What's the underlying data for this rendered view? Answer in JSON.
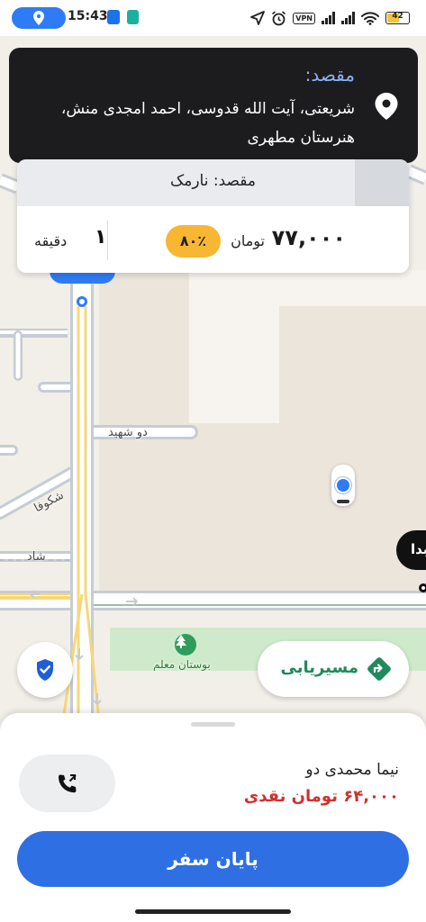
{
  "status_bar": {
    "time": "15:43",
    "vpn_label": "VPN",
    "battery": "42",
    "icons": [
      "location-pill-icon",
      "app-notification-icon",
      "android-icon",
      "navigation-icon",
      "alarm-icon",
      "signal-icon",
      "signal-icon",
      "wifi-icon",
      "battery-icon"
    ]
  },
  "destination_header": {
    "title": "مقصد:",
    "address": "شریعتی، آیت الله قدوسی، احمد امجدی منش، هنرستان مطهری",
    "icon": "location-pin-icon"
  },
  "fare_card": {
    "destination": "مقصد: نارمک",
    "price": "۷۷,۰۰۰",
    "unit": "تومان",
    "discount": "۸۰٪",
    "eta_value": "۱",
    "eta_unit": "دقیقه"
  },
  "map": {
    "labels": {
      "street_do_shahid": "دو شهید",
      "street_shokufa": "شکوفا",
      "street_shad": "شاد",
      "park": "بوستان معلم"
    },
    "origin_bubble": "مبدا",
    "colors": {
      "background": "#f2efe9",
      "road": "#ffffff",
      "arterial": "#f6d77a",
      "route": "#2f7bf6",
      "park": "#cfeacb"
    }
  },
  "actions": {
    "routing": "مسیریابی",
    "end_trip": "پایان سفر"
  },
  "passenger": {
    "name": "نیما محمدی دو",
    "payment": "۶۴,۰۰۰ تومان نقدی"
  },
  "colors": {
    "primary": "#2f6fe4",
    "accent_green": "#1f8a5b",
    "discount": "#f7b733",
    "cash_red": "#d32f2f",
    "dark_card": "#1c1c1e"
  }
}
